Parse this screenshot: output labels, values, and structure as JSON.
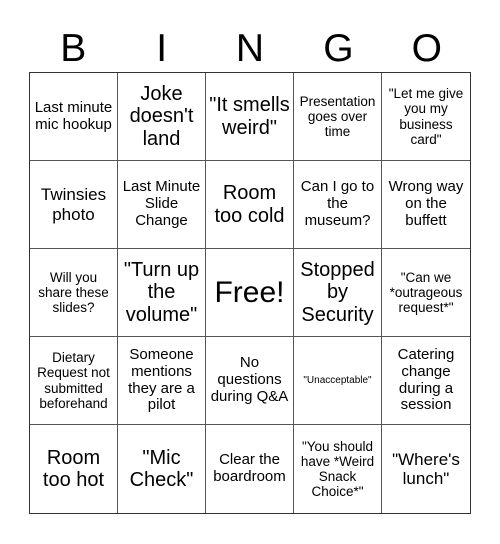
{
  "header": {
    "letters": [
      "B",
      "I",
      "N",
      "G",
      "O"
    ]
  },
  "cells": [
    {
      "text": "Last minute mic hookup",
      "size": "s15"
    },
    {
      "text": "Joke doesn't land",
      "size": "s20"
    },
    {
      "text": "\"It smells weird\"",
      "size": "s20"
    },
    {
      "text": "Presentation goes over time",
      "size": "s13"
    },
    {
      "text": "\"Let me give you my business card\"",
      "size": "s13"
    },
    {
      "text": "Twinsies photo",
      "size": "s17"
    },
    {
      "text": "Last Minute Slide Change",
      "size": "s15"
    },
    {
      "text": "Room too cold",
      "size": "s20"
    },
    {
      "text": "Can I go to the museum?",
      "size": "s15"
    },
    {
      "text": "Wrong way on the buffett",
      "size": "s15"
    },
    {
      "text": "Will you share these slides?",
      "size": "s13"
    },
    {
      "text": "\"Turn up the volume\"",
      "size": "s20"
    },
    {
      "text": "Free!",
      "size": "s30"
    },
    {
      "text": "Stopped by Security",
      "size": "s20"
    },
    {
      "text": "\"Can we *outrageous request*\"",
      "size": "s13"
    },
    {
      "text": "Dietary Request not submitted beforehand",
      "size": "s13"
    },
    {
      "text": "Someone mentions they are a pilot",
      "size": "s15"
    },
    {
      "text": "No questions during Q&A",
      "size": "s15"
    },
    {
      "text": "\"Unacceptable\"",
      "size": "s10"
    },
    {
      "text": "Catering change during a session",
      "size": "s15"
    },
    {
      "text": "Room too hot",
      "size": "s20"
    },
    {
      "text": "\"Mic Check\"",
      "size": "s20"
    },
    {
      "text": "Clear the boardroom",
      "size": "s15"
    },
    {
      "text": "\"You should have *Weird Snack Choice*\"",
      "size": "s13"
    },
    {
      "text": "\"Where's lunch\"",
      "size": "s17"
    }
  ]
}
